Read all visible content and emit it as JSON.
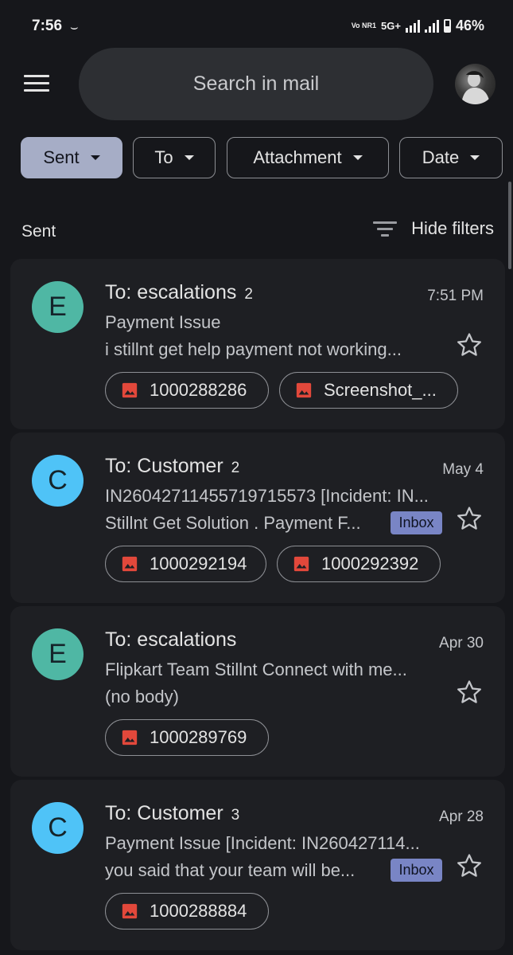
{
  "status": {
    "time": "7:56",
    "carrier": "Vo NR1",
    "network": "5G+",
    "battery": "46%",
    "battery_level": 0.46
  },
  "search": {
    "placeholder": "Search in mail"
  },
  "chips": [
    {
      "label": "Sent",
      "selected": true
    },
    {
      "label": "To",
      "selected": false
    },
    {
      "label": "Attachment",
      "selected": false
    },
    {
      "label": "Date",
      "selected": false
    }
  ],
  "section": {
    "title": "Sent",
    "hide_filters": "Hide filters"
  },
  "emails": [
    {
      "avatar": "E",
      "avatar_color": "#4fb7a4",
      "to": "To: escalations",
      "count": "2",
      "date": "7:51 PM",
      "subject": "Payment Issue",
      "snippet": "i stillnt get help payment not working...",
      "badge": "",
      "attachments": [
        "1000288286",
        "Screenshot_..."
      ]
    },
    {
      "avatar": "C",
      "avatar_color": "#4fc3f7",
      "to": "To: Customer",
      "count": "2",
      "date": "May 4",
      "subject": "IN26042711455719715573 [Incident: IN...",
      "snippet": "Stillnt Get Solution . Payment F...",
      "badge": "Inbox",
      "attachments": [
        "1000292194",
        "1000292392"
      ]
    },
    {
      "avatar": "E",
      "avatar_color": "#4fb7a4",
      "to": "To: escalations",
      "count": "",
      "date": "Apr 30",
      "subject": "Flipkart Team Stillnt Connect with me...",
      "snippet": "(no body)",
      "badge": "",
      "attachments": [
        "1000289769"
      ]
    },
    {
      "avatar": "C",
      "avatar_color": "#4fc3f7",
      "to": "To: Customer",
      "count": "3",
      "date": "Apr 28",
      "subject": "Payment Issue [Incident: IN260427114...",
      "snippet": "you said that your team will be...",
      "badge": "Inbox",
      "attachments": [
        "1000288884"
      ]
    }
  ],
  "colors": {
    "background": "#16171b",
    "card": "#1e1f23",
    "chip_selected": "#a6adc6",
    "badge": "#7985c5",
    "attachment_icon": "#e2483b"
  },
  "icons": [
    "menu-icon",
    "caret-down-icon",
    "filter-icon",
    "star-icon",
    "image-icon"
  ]
}
